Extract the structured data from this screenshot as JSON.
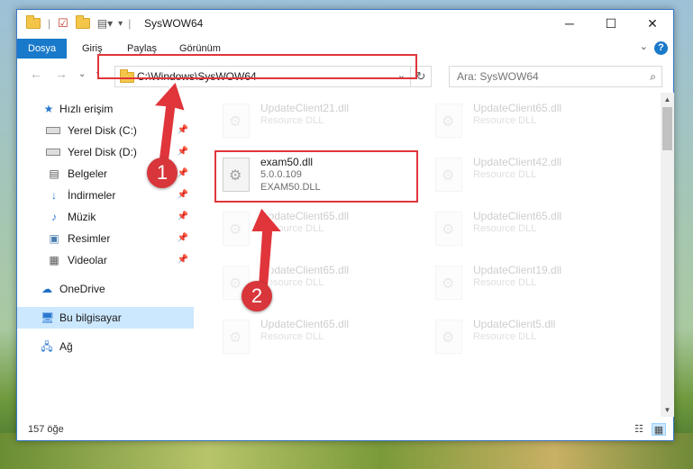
{
  "window": {
    "title": "SysWOW64",
    "controls": {
      "minimize": "─",
      "maximize": "☐",
      "close": "✕"
    }
  },
  "ribbon": {
    "tabs": [
      {
        "label": "Dosya",
        "active": true
      },
      {
        "label": "Giriş"
      },
      {
        "label": "Paylaş"
      },
      {
        "label": "Görünüm"
      }
    ],
    "help": "?"
  },
  "navigation": {
    "address": "C:\\Windows\\SysWOW64",
    "search_placeholder": "Ara: SysWOW64"
  },
  "sidebar": {
    "items": [
      {
        "label": "Hızlı erişim",
        "icon": "star-icon"
      },
      {
        "label": "Yerel Disk (C:)",
        "icon": "drive-icon",
        "pinned": true
      },
      {
        "label": "Yerel Disk (D:)",
        "icon": "drive-icon",
        "pinned": true
      },
      {
        "label": "Belgeler",
        "icon": "documents-icon",
        "pinned": true
      },
      {
        "label": "İndirmeler",
        "icon": "download-icon",
        "pinned": true
      },
      {
        "label": "Müzik",
        "icon": "music-icon",
        "pinned": true
      },
      {
        "label": "Resimler",
        "icon": "pictures-icon",
        "pinned": true
      },
      {
        "label": "Videolar",
        "icon": "videos-icon",
        "pinned": true
      },
      {
        "label": "OneDrive",
        "icon": "cloud-icon"
      },
      {
        "label": "Bu bilgisayar",
        "icon": "computer-icon",
        "selected": true
      },
      {
        "label": "Ağ",
        "icon": "network-icon"
      }
    ]
  },
  "files": {
    "highlighted": {
      "name": "exam50.dll",
      "version": "5.0.0.109",
      "description": "EXAM50.DLL"
    },
    "background": [
      {
        "name": "UpdateClient21.dll",
        "type": "Resource DLL"
      },
      {
        "name": "UpdateClient65.dll",
        "type": "Resource DLL"
      },
      {
        "name": "UpdateClient42.dll",
        "type": "Resource DLL"
      },
      {
        "name": "UpdateClient65.dll",
        "type": "Resource DLL"
      },
      {
        "name": "UpdateClient65.dll",
        "type": "Resource DLL"
      },
      {
        "name": "UpdateClient65.dll",
        "type": "Resource DLL"
      },
      {
        "name": "UpdateClient19.dll",
        "type": "Resource DLL"
      },
      {
        "name": "UpdateClient65.dll",
        "type": "Resource DLL"
      },
      {
        "name": "UpdateClient5.dll",
        "type": "Resource DLL"
      }
    ]
  },
  "status": {
    "count": "157 öğe"
  },
  "annotations": {
    "step1": "1",
    "step2": "2",
    "highlight_color": "#e0353b"
  }
}
